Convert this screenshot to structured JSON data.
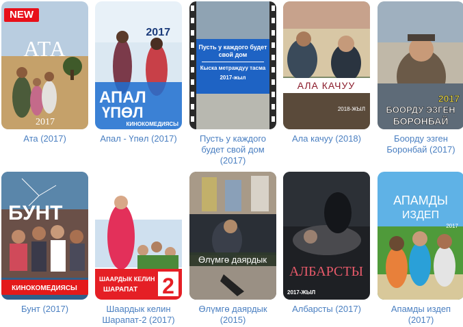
{
  "movies": [
    {
      "title": "Ата (2017)",
      "poster_text": [
        "АТА",
        "2017"
      ],
      "badge": "NEW"
    },
    {
      "title": "Апал - Үпөл (2017)",
      "poster_text": [
        "2017",
        "АПАЛ",
        "ҮПӨЛ",
        "КИНОКОМЕДИЯСЫ"
      ]
    },
    {
      "title": "Пусть у каждого будет свой дом (2017)",
      "poster_text": [
        "Пусть у каждого будет свой дом",
        "Кыска метраждуу тасма",
        "2017-жыл"
      ]
    },
    {
      "title": "Ала качуу (2018)",
      "poster_text": [
        "АЛА КАЧУУ",
        "2018-ЖЫЛ"
      ]
    },
    {
      "title": "Боорду эзген Боронбай (2017)",
      "poster_text": [
        "2017",
        "БООРДУ ЭЗГЕН",
        "БОРОНБАЙ"
      ]
    },
    {
      "title": "Бунт (2017)",
      "poster_text": [
        "БУНТ",
        "КИНОКОМЕДИЯСЫ"
      ]
    },
    {
      "title": "Шаардык келин Шарапат-2 (2017)",
      "poster_text": [
        "ШААРДЫК КЕЛИН",
        "ШАРАПАТ",
        "2"
      ]
    },
    {
      "title": "Өлүмгө даярдык (2015)",
      "poster_text": [
        "Өлүмгө даярдык"
      ]
    },
    {
      "title": "Албарсты (2017)",
      "poster_text": [
        "АЛБАРСТЫ",
        "2017-ЖЫЛ"
      ]
    },
    {
      "title": "Апамды издеп (2017)",
      "poster_text": [
        "АПАМДЫ",
        "ИЗДЕП",
        "2017"
      ]
    }
  ]
}
